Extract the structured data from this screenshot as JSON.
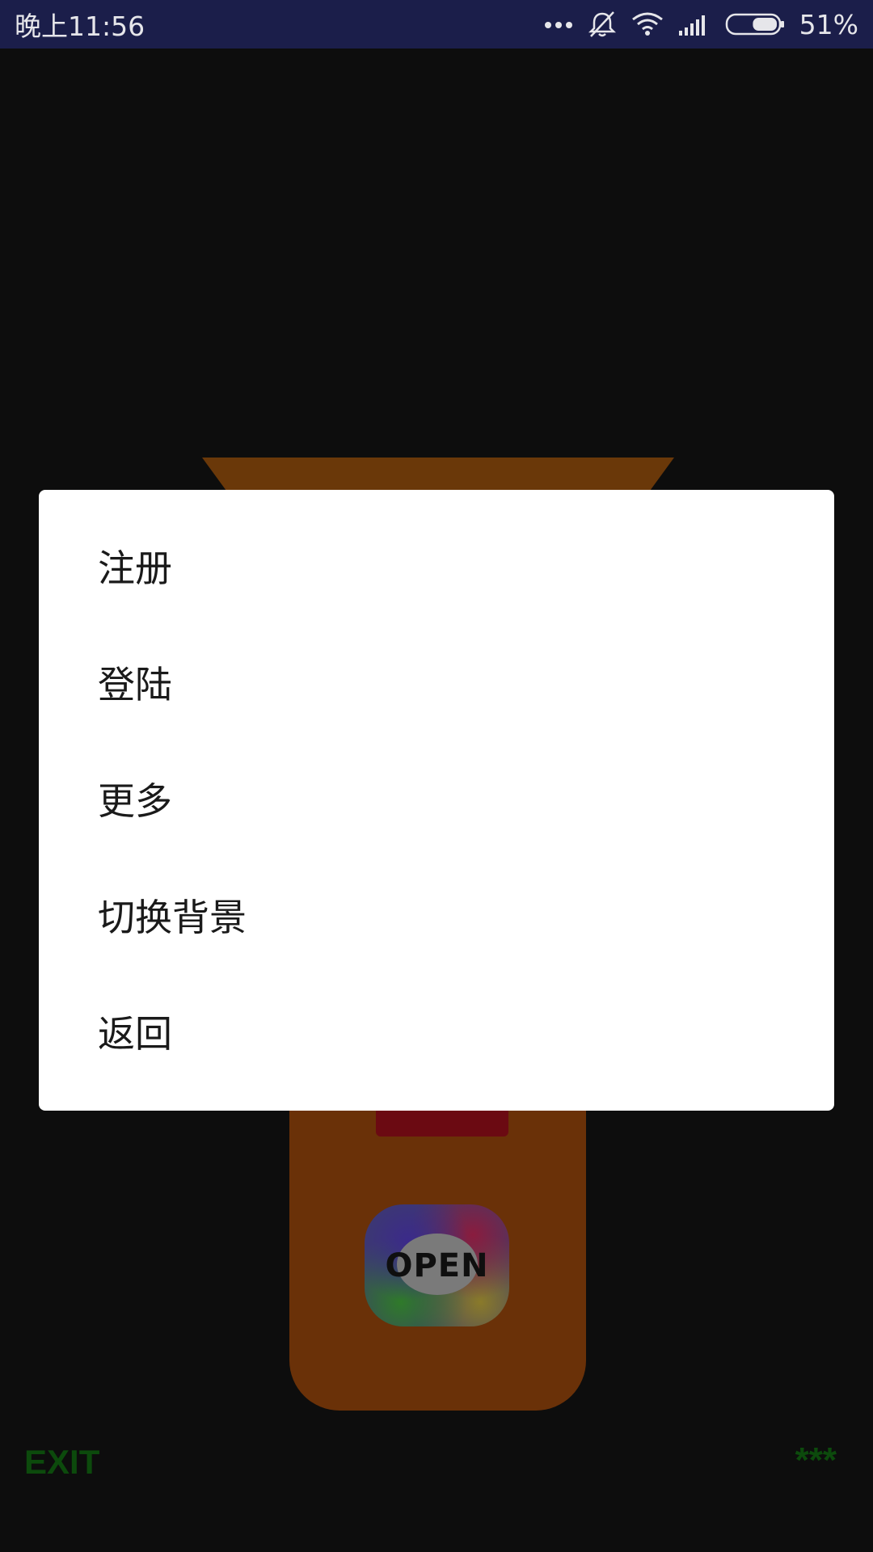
{
  "status_bar": {
    "time": "晚上11:56",
    "battery_percent_label": "51%",
    "battery_level": 0.51,
    "icons": [
      "more-dots-icon",
      "notifications-off-icon",
      "wifi-icon",
      "signal-icon",
      "battery-icon"
    ]
  },
  "background_app": {
    "open_button_label": "OPEN",
    "exit_label": "EXIT",
    "stars_label": "***"
  },
  "dialog": {
    "items": [
      {
        "label": "注册"
      },
      {
        "label": "登陆"
      },
      {
        "label": "更多"
      },
      {
        "label": "切换背景"
      },
      {
        "label": "返回"
      }
    ]
  },
  "colors": {
    "status_bar_bg": "#1b1e4a",
    "dim_bg": "#0d0d0d",
    "machine_orange": "#6a3108",
    "accent_green": "#0c4a0c",
    "dialog_bg": "#ffffff"
  }
}
